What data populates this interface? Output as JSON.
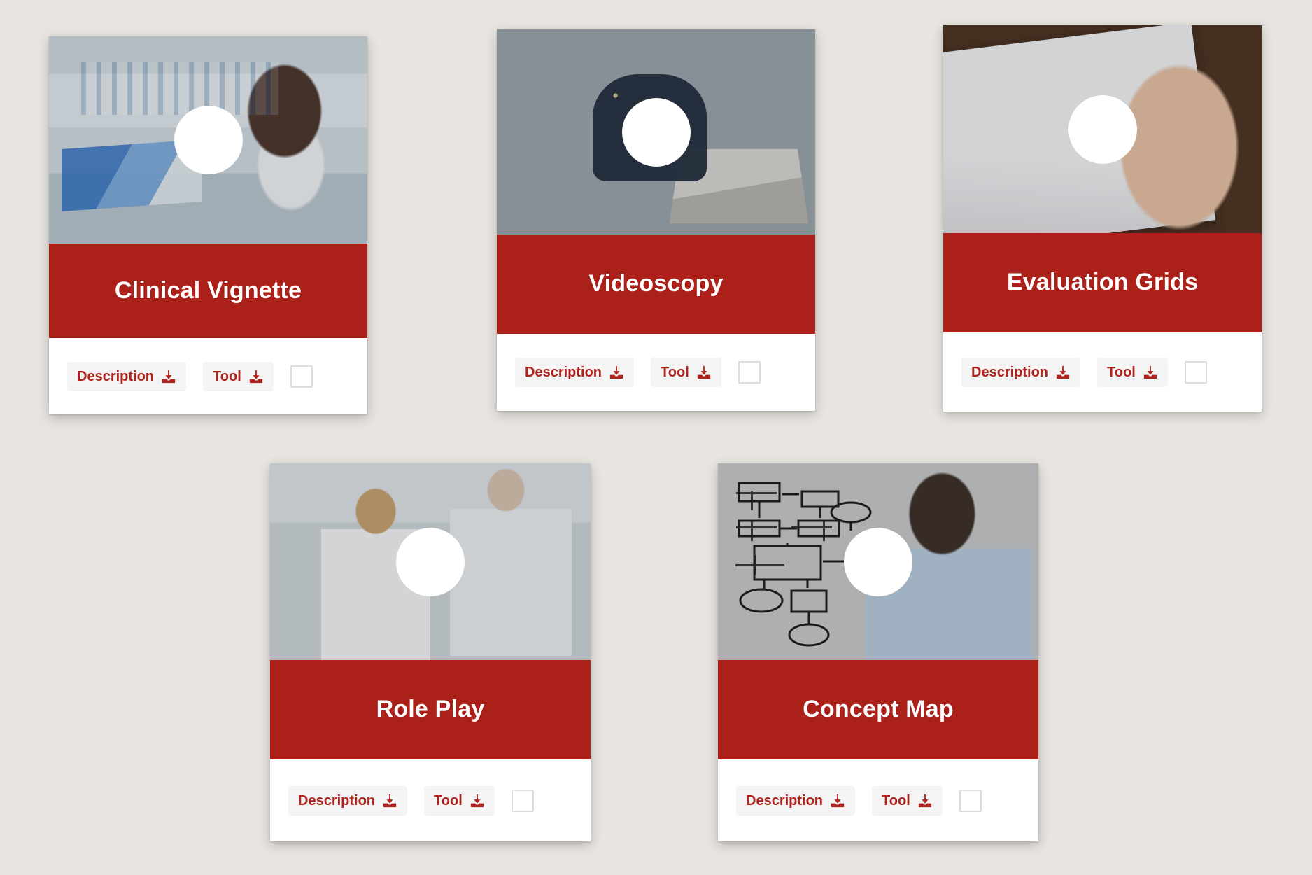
{
  "theme": {
    "page_background": "#E8E5E0",
    "band_red": "#AB2019",
    "button_text_red": "#B0231C",
    "button_background": "#F4F4F4",
    "card_background": "#FFFFFF",
    "checkbox_border": "#DDDDDD"
  },
  "labels": {
    "description": "Description",
    "tool": "Tool",
    "play_icon": "play-icon",
    "download_icon": "download-icon",
    "checkbox": "selection-checkbox"
  },
  "cards": [
    {
      "id": "clinical-vignette",
      "title": "Clinical Vignette",
      "thumbnail_alt": "Scientist in a laboratory reviewing documents in a binder",
      "description_label": "Description",
      "tool_label": "Tool",
      "checked": false
    },
    {
      "id": "videoscopy",
      "title": "Videoscopy",
      "thumbnail_alt": "Woman with a headset taking notes in front of a laptop",
      "description_label": "Description",
      "tool_label": "Tool",
      "checked": false
    },
    {
      "id": "evaluation-grids",
      "title": "Evaluation Grids",
      "thumbnail_alt": "Hand holding a pen filling in a printed form on a wooden desk",
      "description_label": "Description",
      "tool_label": "Tool",
      "checked": false
    },
    {
      "id": "role-play",
      "title": "Role Play",
      "thumbnail_alt": "Three lab technicians in white coats working together at a bench",
      "description_label": "Description",
      "tool_label": "Tool",
      "checked": false
    },
    {
      "id": "concept-map",
      "title": "Concept Map",
      "thumbnail_alt": "Woman drawing a flowchart diagram on a transparent glass board",
      "description_label": "Description",
      "tool_label": "Tool",
      "checked": false
    }
  ]
}
